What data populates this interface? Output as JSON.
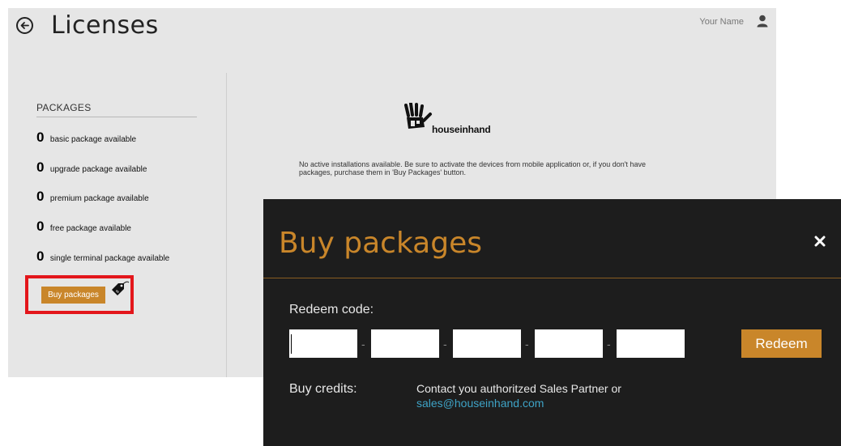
{
  "page": {
    "title": "Licenses",
    "user_name": "Your Name"
  },
  "packages": {
    "header": "PACKAGES",
    "items": [
      {
        "count": "0",
        "label": "basic package available"
      },
      {
        "count": "0",
        "label": "upgrade package available"
      },
      {
        "count": "0",
        "label": "premium package available"
      },
      {
        "count": "0",
        "label": "free package available"
      },
      {
        "count": "0",
        "label": "single terminal package available"
      }
    ],
    "buy_button": "Buy packages"
  },
  "content": {
    "logo_text": "houseinhand",
    "message": "No active installations available. Be sure to activate the devices from mobile application or, if you don't have packages, purchase them in 'Buy Packages' button."
  },
  "modal": {
    "title": "Buy packages",
    "redeem_label": "Redeem code:",
    "code_fields": [
      "",
      "",
      "",
      "",
      ""
    ],
    "separator": "-",
    "redeem_button": "Redeem",
    "credits_label": "Buy credits:",
    "contact_text": "Contact you authoritzed Sales Partner or",
    "contact_email": "sales@houseinhand.com"
  },
  "colors": {
    "accent": "#c9862a",
    "highlight": "#e3161b",
    "link": "#3ea3c6"
  }
}
